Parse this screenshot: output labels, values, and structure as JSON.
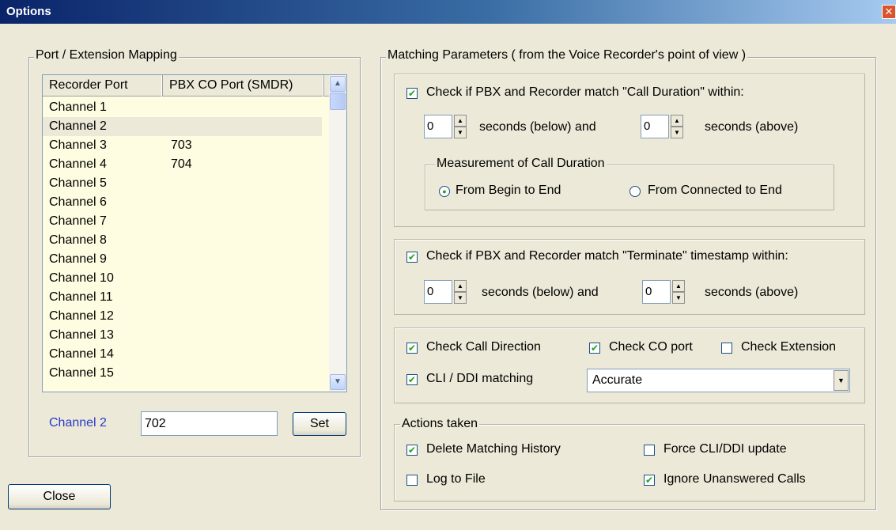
{
  "window": {
    "title": "Options"
  },
  "mapping": {
    "legend": "Port / Extension Mapping",
    "columns": [
      "Recorder Port",
      "PBX CO Port (SMDR)"
    ],
    "rows": [
      {
        "port": "Channel 1",
        "co": ""
      },
      {
        "port": "Channel 2",
        "co": ""
      },
      {
        "port": "Channel 3",
        "co": "703"
      },
      {
        "port": "Channel 4",
        "co": "704"
      },
      {
        "port": "Channel 5",
        "co": ""
      },
      {
        "port": "Channel 6",
        "co": ""
      },
      {
        "port": "Channel 7",
        "co": ""
      },
      {
        "port": "Channel 8",
        "co": ""
      },
      {
        "port": "Channel 9",
        "co": ""
      },
      {
        "port": "Channel 10",
        "co": ""
      },
      {
        "port": "Channel 11",
        "co": ""
      },
      {
        "port": "Channel 12",
        "co": ""
      },
      {
        "port": "Channel 13",
        "co": ""
      },
      {
        "port": "Channel 14",
        "co": ""
      },
      {
        "port": "Channel 15",
        "co": ""
      }
    ],
    "selected_label": "Channel 2",
    "value": "702",
    "set_label": "Set"
  },
  "close_label": "Close",
  "matching": {
    "legend": "Matching Parameters ( from the Voice Recorder's point of view )",
    "duration": {
      "check_label": "Check if PBX and Recorder match \"Call Duration\" within:",
      "checked": true,
      "below_value": "0",
      "below_label": "seconds (below) and",
      "above_value": "0",
      "above_label": "seconds (above)",
      "measurement_legend": "Measurement of Call Duration",
      "opt_begin": "From Begin to End",
      "opt_connected": "From Connected to End"
    },
    "terminate": {
      "check_label": "Check if PBX and Recorder match \"Terminate\" timestamp within:",
      "checked": true,
      "below_value": "0",
      "below_label": "seconds (below) and",
      "above_value": "0",
      "above_label": "seconds (above)"
    },
    "checks": {
      "call_direction": "Check Call Direction",
      "co_port": "Check CO port",
      "extension": "Check Extension",
      "cli_ddi": "CLI / DDI matching",
      "cli_mode": "Accurate"
    },
    "actions": {
      "legend": "Actions taken",
      "delete_history": "Delete Matching History",
      "force_update": "Force CLI/DDI update",
      "log_file": "Log to File",
      "ignore_unanswered": "Ignore Unanswered Calls"
    }
  }
}
